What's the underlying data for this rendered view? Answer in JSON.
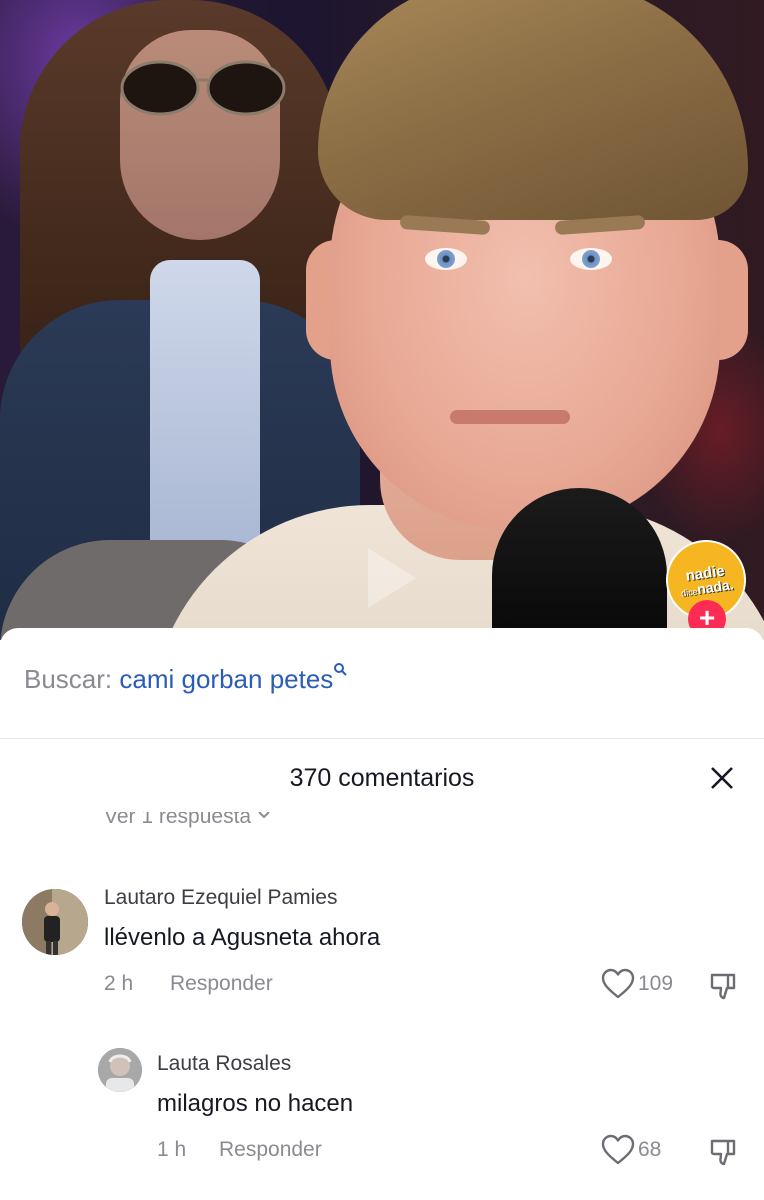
{
  "video": {
    "channel_logo": {
      "line1": "nadie",
      "line2_small": "dice",
      "line2": "nada.",
      "color": "#f5b622"
    },
    "follow_button": "+",
    "play_icon": "play-icon"
  },
  "search": {
    "label": "Buscar:",
    "term": "cami gorban petes",
    "icon": "search-icon",
    "term_color": "#2b5db6"
  },
  "comments_header": {
    "title": "370 comentarios",
    "close_icon": "close-icon"
  },
  "view_replies": {
    "label": "Ver 1 respuesta",
    "icon": "chevron-down-icon"
  },
  "comments": [
    {
      "username": "Lautaro Ezequiel Pamies",
      "text": "llévenlo a Agusneta ahora",
      "time": "2 h",
      "reply_label": "Responder",
      "likes": "109"
    },
    {
      "username": "Lauta Rosales",
      "text": "milagros no hacen",
      "time": "1 h",
      "reply_label": "Responder",
      "likes": "68"
    }
  ],
  "accent_color": "#fe2c55"
}
